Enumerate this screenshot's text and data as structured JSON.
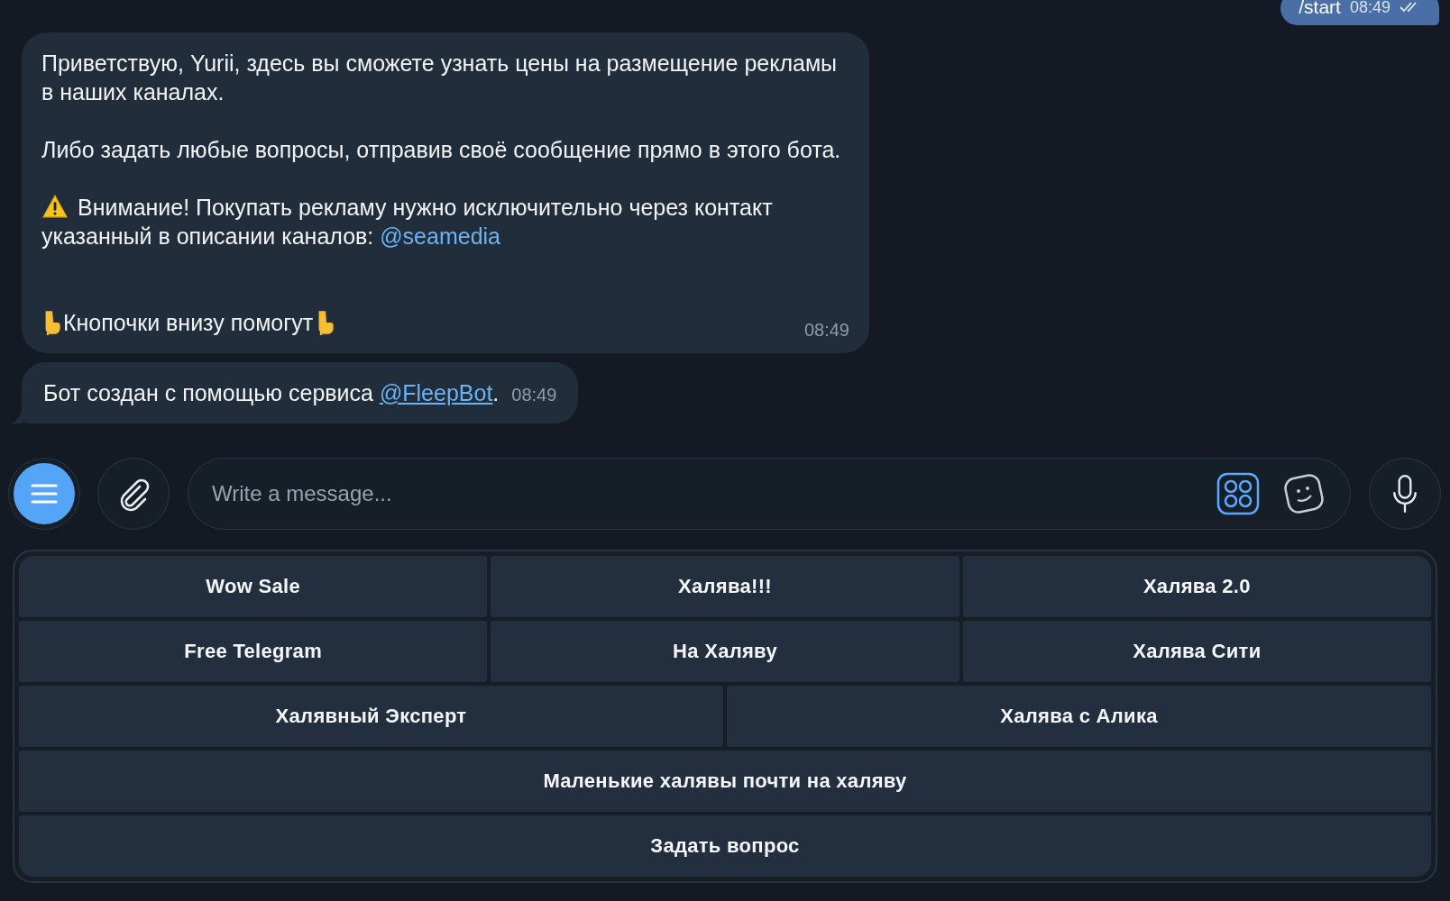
{
  "outgoing": {
    "text": "/start",
    "time": "08:49"
  },
  "messages": [
    {
      "paragraphs": [
        {
          "kind": "text",
          "text": "Приветствую, Yurii, здесь вы сможете узнать цены на размещение рекламы в наших каналах."
        },
        {
          "kind": "text",
          "text": "Либо задать любые вопросы, отправив своё сообщение прямо в этого бота."
        },
        {
          "kind": "warning",
          "text": "Внимание! Покупать рекламу нужно исключительно через контакт указанный в описании каналов: ",
          "link": "@seamedia"
        },
        {
          "kind": "pointer",
          "text": "Кнопочки внизу помогут"
        }
      ],
      "time": "08:49",
      "tail": false
    },
    {
      "paragraphs": [
        {
          "kind": "text",
          "text": "Бот создан с помощью сервиса ",
          "link": "@FleepBot",
          "after": "."
        }
      ],
      "time": "08:49",
      "tail": true
    }
  ],
  "composer": {
    "placeholder": "Write a message..."
  },
  "keyboard": {
    "rows": [
      [
        "Wow Sale",
        "Халява!!!",
        "Халява 2.0"
      ],
      [
        "Free Telegram",
        "На Халяву",
        "Халява Сити"
      ],
      [
        "Халявный Эксперт",
        "Халява с Алика"
      ],
      [
        "Маленькие халявы почти на халяву"
      ],
      [
        "Задать вопрос"
      ]
    ]
  }
}
